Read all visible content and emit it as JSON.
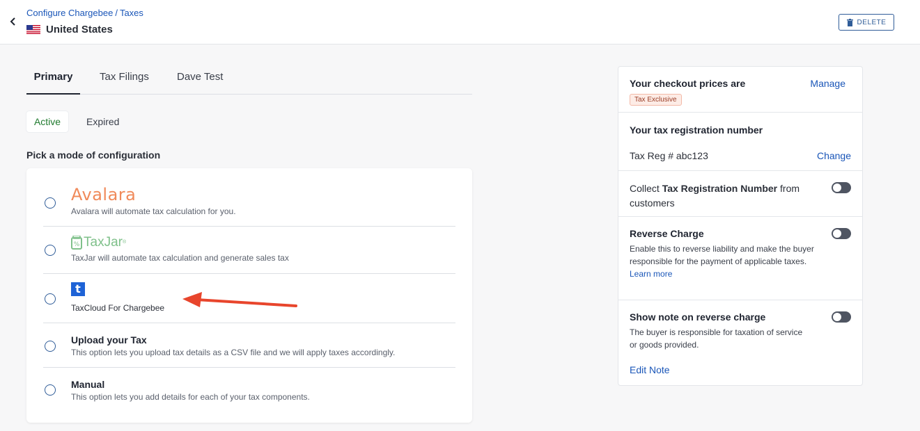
{
  "header": {
    "breadcrumb": [
      "Configure Chargebee",
      "Taxes"
    ],
    "breadcrumb_separator": "/",
    "title": "United States",
    "flag_icon": "us-flag-icon",
    "delete_label": "DELETE"
  },
  "tabs": [
    {
      "label": "Primary",
      "active": true
    },
    {
      "label": "Tax Filings",
      "active": false
    },
    {
      "label": "Dave Test",
      "active": false
    }
  ],
  "status_filters": [
    {
      "label": "Active",
      "active": true
    },
    {
      "label": "Expired",
      "active": false
    }
  ],
  "section_title": "Pick a mode of configuration",
  "options": [
    {
      "logo": "Avalara",
      "description": "Avalara will automate tax calculation for you."
    },
    {
      "logo": "TaxJar",
      "description": "TaxJar will automate tax calculation and generate sales tax"
    },
    {
      "logo": "t",
      "description": "TaxCloud For Chargebee"
    },
    {
      "title": "Upload your Tax",
      "description": "This option lets you upload tax details as a CSV file and we will apply taxes accordingly."
    },
    {
      "title": "Manual",
      "description": "This option lets you add details for each of your tax components."
    }
  ],
  "side": {
    "checkout_title": "Your checkout prices are",
    "manage_label": "Manage",
    "tax_badge": "Tax Exclusive",
    "reg_title": "Your tax registration number",
    "reg_value": "Tax Reg # abc123",
    "change_label": "Change",
    "collect_prefix": "Collect ",
    "collect_bold": "Tax Registration Number",
    "collect_suffix": " from customers",
    "reverse_title": "Reverse Charge",
    "reverse_desc": "Enable this to reverse liability and make the buyer responsible for the payment of applicable taxes.",
    "learn_more": "Learn more",
    "note_title": "Show note on reverse charge",
    "note_desc": "The buyer is responsible for taxation of service or goods provided.",
    "edit_note": "Edit Note"
  },
  "colors": {
    "link": "#1a56b8",
    "active_green": "#1f7a2e",
    "avalara_orange": "#f08a5a",
    "taxjar_green": "#7fc08a",
    "taxcloud_blue": "#1e63d6",
    "annotation_arrow": "#e8452c"
  }
}
